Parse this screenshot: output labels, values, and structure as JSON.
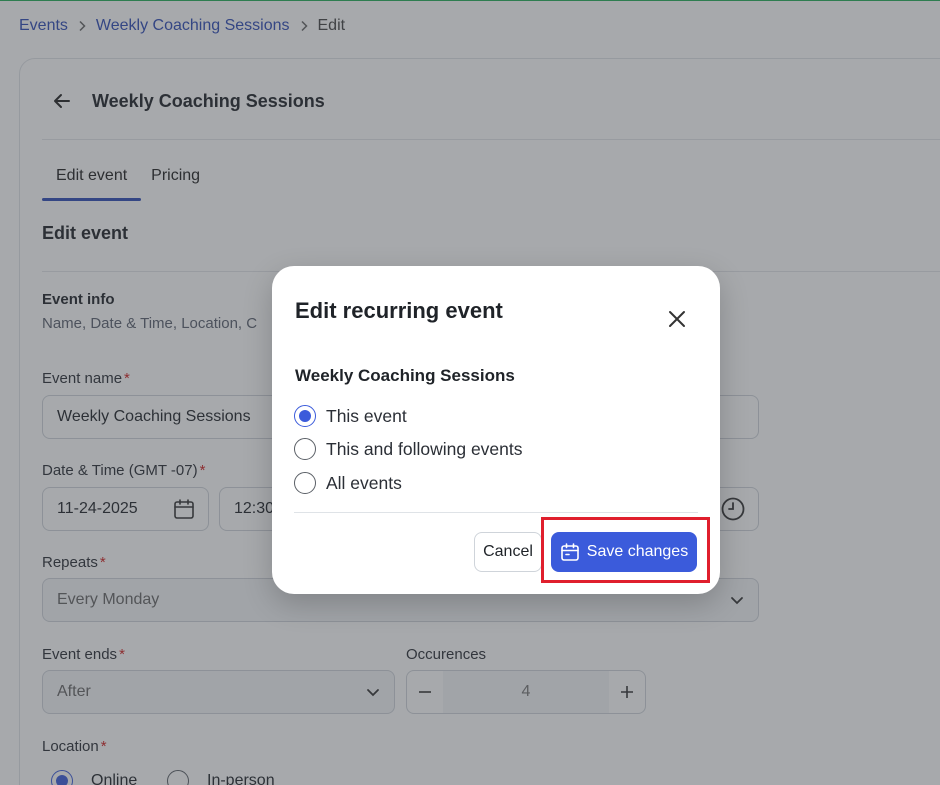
{
  "breadcrumb": {
    "events": "Events",
    "series": "Weekly Coaching Sessions",
    "current": "Edit"
  },
  "header": {
    "title": "Weekly Coaching Sessions"
  },
  "tabs": [
    {
      "label": "Edit event"
    },
    {
      "label": "Pricing"
    }
  ],
  "section": {
    "title": "Edit event"
  },
  "event_info": {
    "title": "Event info",
    "subtitle": "Name, Date & Time, Location, C"
  },
  "form": {
    "name_label": "Event name",
    "name_value": "Weekly Coaching Sessions",
    "datetime_label": "Date & Time (GMT -07)",
    "date_value": "11-24-2025",
    "time_value": "12:30",
    "repeats_label": "Repeats",
    "repeats_value": "Every Monday",
    "ends_label": "Event ends",
    "ends_value": "After",
    "occurrences_label": "Occurences",
    "occurrences_value": "4",
    "location_label": "Location",
    "location_online": "Online",
    "location_inperson": "In-person",
    "required_mark": "*"
  },
  "modal": {
    "title": "Edit recurring event",
    "event_name": "Weekly Coaching Sessions",
    "options": [
      {
        "label": "This event",
        "selected": true
      },
      {
        "label": "This and following events",
        "selected": false
      },
      {
        "label": "All events",
        "selected": false
      }
    ],
    "cancel_label": "Cancel",
    "save_label": "Save changes"
  },
  "colors": {
    "accent": "#3b5bdb",
    "link": "#2f4bb6",
    "required": "#d01f1f",
    "highlight": "#e01f2d"
  }
}
